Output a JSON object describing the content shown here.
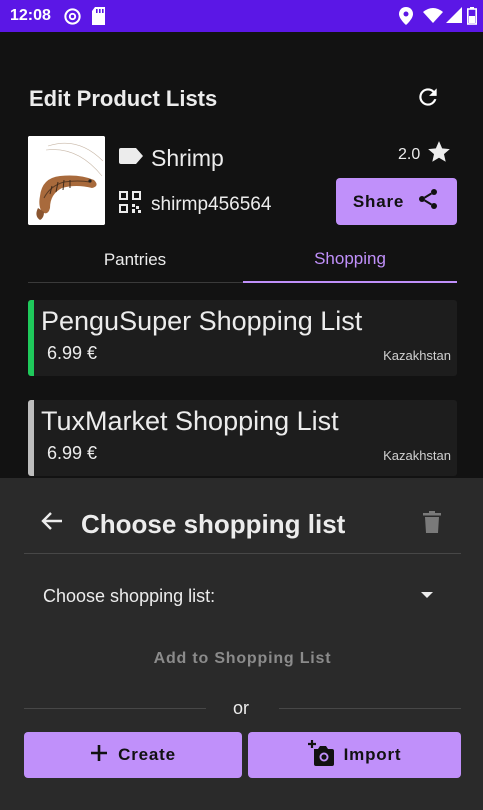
{
  "status_bar": {
    "time": "12:08"
  },
  "header": {
    "title": "Edit Product Lists"
  },
  "product": {
    "name": "Shrimp",
    "code": "shirmp456564",
    "rating": "2.0",
    "share_label": "Share"
  },
  "tabs": [
    {
      "label": "Pantries",
      "selected": false
    },
    {
      "label": "Shopping",
      "selected": true
    }
  ],
  "lists": [
    {
      "name": "PenguSuper Shopping List",
      "price": "6.99 €",
      "country": "Kazakhstan",
      "accent": "#1fc95b"
    },
    {
      "name": "TuxMarket Shopping List",
      "price": "6.99 €",
      "country": "Kazakhstan",
      "accent": "#bdbdbd"
    }
  ],
  "sheet": {
    "title": "Choose shopping list",
    "choose_label": "Choose shopping list:",
    "add_label": "Add to Shopping List",
    "or_label": "or",
    "create_label": "Create",
    "import_label": "Import"
  },
  "colors": {
    "accent": "#c090fa",
    "status_bar": "#5b17e6",
    "background": "#121212",
    "sheet": "#2a2a2a"
  }
}
